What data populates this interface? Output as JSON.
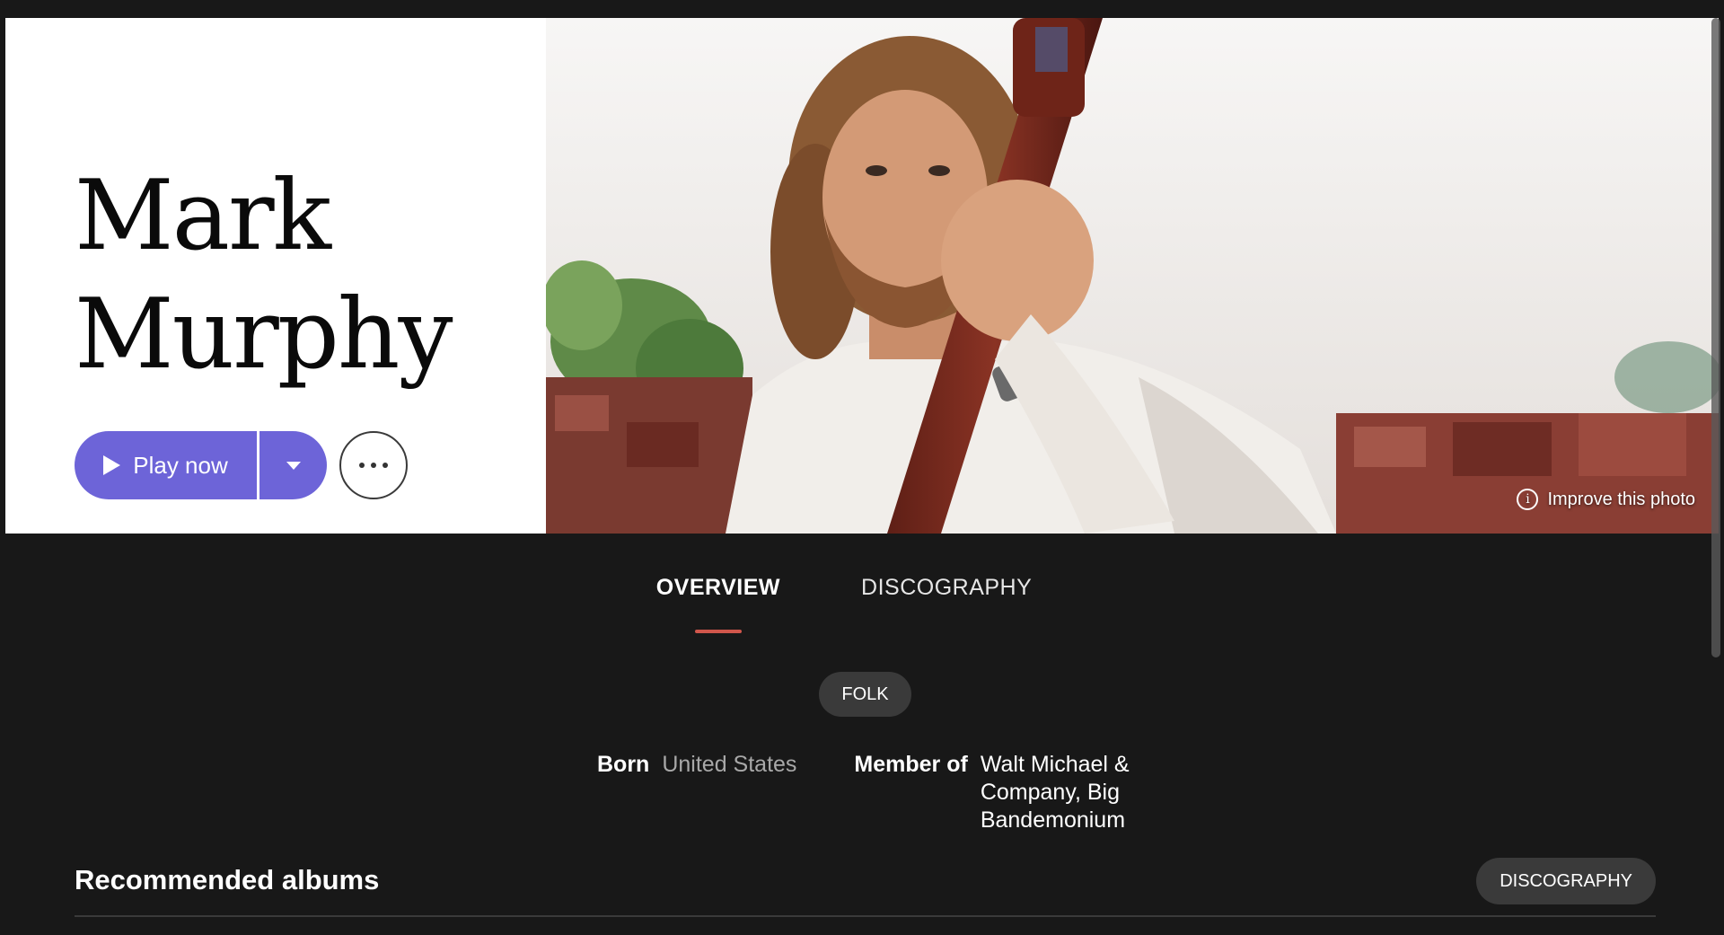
{
  "artist": {
    "name_line1": "Mark",
    "name_line2": "Murphy"
  },
  "actions": {
    "play_label": "Play now"
  },
  "photo": {
    "improve_label": "Improve this photo",
    "info_icon": "i"
  },
  "tabs": [
    {
      "label": "OVERVIEW",
      "active": true
    },
    {
      "label": "DISCOGRAPHY",
      "active": false
    }
  ],
  "genre": "FOLK",
  "facts": {
    "born_label": "Born",
    "born_value": "United States",
    "member_label": "Member of",
    "member_items": [
      "Walt Michael & Company",
      "Big Bandemonium"
    ],
    "member_separator": ", "
  },
  "recommended": {
    "title": "Recommended albums",
    "discography_button": "DISCOGRAPHY"
  },
  "colors": {
    "accent_purple": "#6d64d8",
    "tab_underline": "#d0564b",
    "background": "#181818",
    "pill": "#3a3a3a"
  },
  "icons": [
    "play-icon",
    "chevron-down-icon",
    "more-icon",
    "info-icon"
  ]
}
